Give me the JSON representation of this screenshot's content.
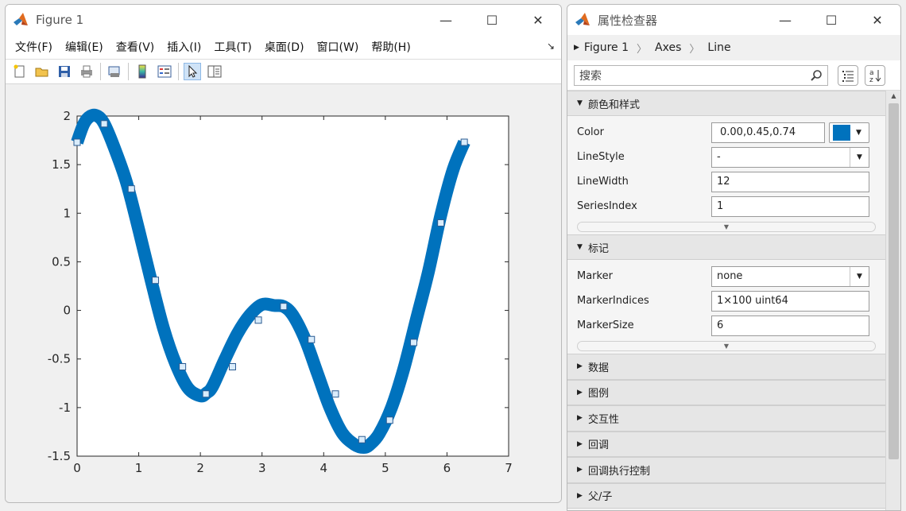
{
  "figure": {
    "title": "Figure 1",
    "menu": [
      "文件(F)",
      "编辑(E)",
      "查看(V)",
      "插入(I)",
      "工具(T)",
      "桌面(D)",
      "窗口(W)",
      "帮助(H)"
    ],
    "toolbar_icons": [
      "new-figure-icon",
      "open-icon",
      "save-icon",
      "print-icon",
      "print-preview-icon",
      "colorbar-icon",
      "legend-icon",
      "pointer-icon",
      "property-editor-icon"
    ]
  },
  "inspector": {
    "title": "属性检查器",
    "breadcrumb": [
      "Figure 1",
      "Axes",
      "Line"
    ],
    "search_placeholder": "搜索",
    "sections": {
      "color_style": {
        "title": "颜色和样式",
        "color_label": "Color",
        "color_value": "0.00,0.45,0.74",
        "swatch_color": "#0072BD",
        "linestyle_label": "LineStyle",
        "linestyle_value": "-",
        "linewidth_label": "LineWidth",
        "linewidth_value": "12",
        "seriesindex_label": "SeriesIndex",
        "seriesindex_value": "1"
      },
      "markers": {
        "title": "标记",
        "marker_label": "Marker",
        "marker_value": "none",
        "markerindices_label": "MarkerIndices",
        "markerindices_value": "1×100 uint64",
        "markersize_label": "MarkerSize",
        "markersize_value": "6"
      },
      "collapsed": [
        "数据",
        "图例",
        "交互性",
        "回调",
        "回调执行控制",
        "父/子"
      ]
    }
  },
  "chart_data": {
    "type": "line",
    "title": "",
    "xlabel": "",
    "ylabel": "",
    "xlim": [
      0,
      7
    ],
    "ylim": [
      -1.5,
      2
    ],
    "xticks": [
      0,
      1,
      2,
      3,
      4,
      5,
      6,
      7
    ],
    "yticks": [
      2,
      1.5,
      1,
      0.5,
      0,
      -0.5,
      -1,
      -1.5
    ],
    "line_color": "#0072BD",
    "line_width": 12,
    "grid": false,
    "series": [
      {
        "x": [
          0,
          0.11,
          0.22,
          0.33,
          0.44,
          0.6,
          0.8,
          1.0,
          1.2,
          1.4,
          1.6,
          1.8,
          2.0,
          2.1,
          2.2,
          2.4,
          2.6,
          2.8,
          3.0,
          3.2,
          3.35,
          3.5,
          3.7,
          3.9,
          4.1,
          4.3,
          4.5,
          4.65,
          4.75,
          4.9,
          5.1,
          5.3,
          5.5,
          5.7,
          5.9,
          6.1,
          6.28
        ],
        "y": [
          1.73,
          1.92,
          2.0,
          2.0,
          1.92,
          1.68,
          1.32,
          0.83,
          0.31,
          -0.18,
          -0.55,
          -0.8,
          -0.88,
          -0.85,
          -0.78,
          -0.5,
          -0.24,
          -0.05,
          0.06,
          0.05,
          0.04,
          -0.05,
          -0.3,
          -0.65,
          -1.0,
          -1.26,
          -1.38,
          -1.41,
          -1.38,
          -1.27,
          -1.0,
          -0.6,
          -0.1,
          0.4,
          0.98,
          1.45,
          1.73
        ]
      }
    ],
    "markers": {
      "x": [
        0,
        0.44,
        0.88,
        1.27,
        1.71,
        2.09,
        2.52,
        2.94,
        3.35,
        3.8,
        4.19,
        4.62,
        5.07,
        5.46,
        5.9,
        6.28
      ],
      "y": [
        1.73,
        1.92,
        1.25,
        0.31,
        -0.58,
        -0.86,
        -0.58,
        -0.1,
        0.04,
        -0.3,
        -0.86,
        -1.33,
        -1.13,
        -0.33,
        0.9,
        1.73
      ]
    }
  }
}
